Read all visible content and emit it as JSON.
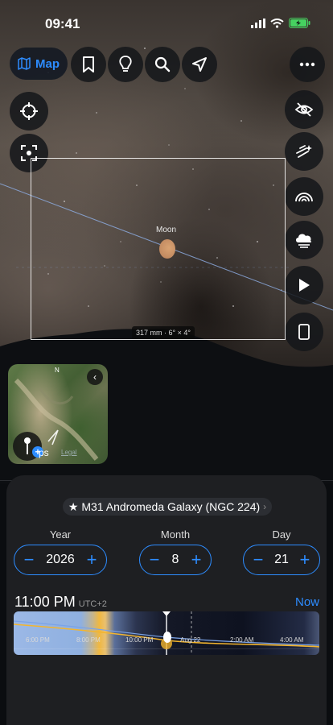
{
  "status_bar": {
    "time": "09:41"
  },
  "toolbar": {
    "map_label": "Map",
    "buttons": [
      "bookmark-icon",
      "lightbulb-icon",
      "search-icon",
      "location-arrow-icon"
    ],
    "more": "more-icon"
  },
  "left_tools": [
    "crosshair-icon",
    "focus-icon"
  ],
  "right_tools": [
    "eye-slash-icon",
    "meteor-icon",
    "rainbow-icon",
    "cloud-icon",
    "play-icon",
    "device-icon"
  ],
  "sky": {
    "moon_label": "Moon",
    "frame_label": "317 mm · 6° × 4°"
  },
  "minimap": {
    "compass": "N",
    "maps_text": "ps",
    "legal": "Legal"
  },
  "object": {
    "name": "M31 Andromeda Galaxy (NGC 224)",
    "star": "★"
  },
  "date": {
    "year": {
      "label": "Year",
      "value": "2026"
    },
    "month": {
      "label": "Month",
      "value": "8"
    },
    "day": {
      "label": "Day",
      "value": "21"
    },
    "minus": "−",
    "plus": "+"
  },
  "time": {
    "value": "11:00 PM",
    "tz": "UTC+2",
    "now_label": "Now"
  },
  "timeline": {
    "ticks": [
      "6:00 PM",
      "8:00 PM",
      "10:00 PM",
      "Aug 22",
      "2:00 AM",
      "4:00 AM"
    ]
  },
  "colors": {
    "accent": "#2d8cff",
    "sheet": "#1e1f22"
  }
}
